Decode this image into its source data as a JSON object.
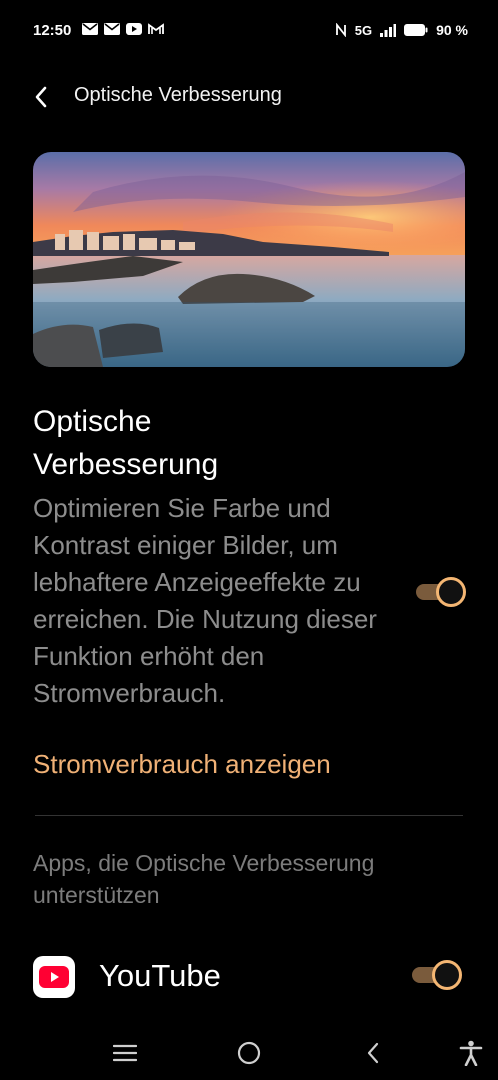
{
  "status_bar": {
    "time": "12:50",
    "left_icons": [
      "gmail-icon",
      "gmail-icon",
      "youtube-icon",
      "gmail-alt-icon"
    ],
    "network": "5G",
    "battery": "90 %"
  },
  "header": {
    "title": "Optische Verbesserung"
  },
  "section": {
    "title": "Optische Verbesserung",
    "description": "Optimieren Sie Farbe und Kontrast einiger Bilder, um lebhaftere Anzeigeeffekte zu erreichen. Die Nutzung dieser Funktion erhöht den Stromverbrauch.",
    "link": "Stromverbrauch anzeigen",
    "toggle_on": true
  },
  "apps_section": {
    "header": "Apps, die Optische Verbesserung unterstützen",
    "apps": [
      {
        "name": "YouTube",
        "toggle_on": true
      }
    ]
  },
  "colors": {
    "accent": "#f4b673",
    "link": "#f0b176",
    "background": "#000000",
    "muted_text": "#8d8d8d"
  }
}
